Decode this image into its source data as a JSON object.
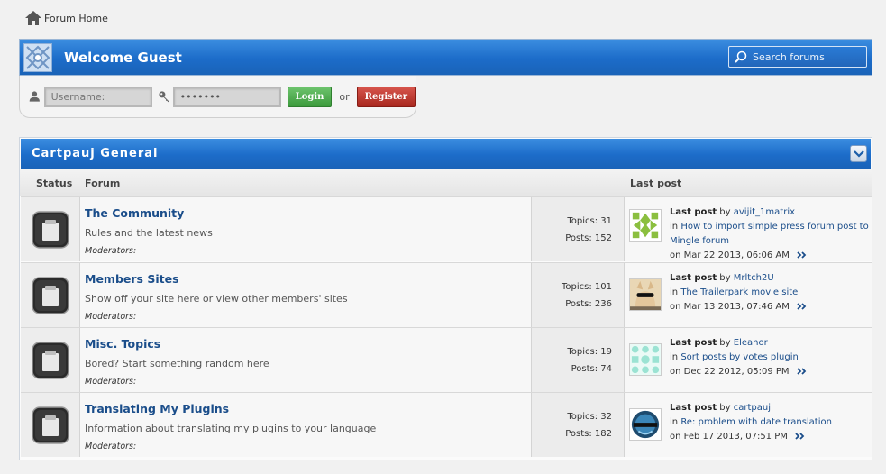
{
  "breadcrumb": {
    "home_label": "Forum Home"
  },
  "welcome": {
    "title": "Welcome Guest",
    "search_placeholder": "Search forums"
  },
  "login": {
    "username_placeholder": "Username:",
    "password_value": "•••••••",
    "login_label": "Login",
    "or_text": "or",
    "register_label": "Register"
  },
  "group": {
    "title": "Cartpauj General",
    "headers": {
      "status": "Status",
      "forum": "Forum",
      "last_post": "Last post"
    }
  },
  "forums": [
    {
      "title": "The Community",
      "description": "Rules and the latest news",
      "moderators": "Moderators:",
      "topics": "Topics: 31",
      "posts": "Posts: 152",
      "last_label": "Last post",
      "by": "by",
      "author": "avijit_1matrix",
      "in": "in",
      "topic_line1": "How to import simple press forum post to",
      "topic_line2": "Mingle forum",
      "date": "on Mar 22 2013, 06:06 AM"
    },
    {
      "title": "Members Sites",
      "description": "Show off your site here or view other members' sites",
      "moderators": "Moderators:",
      "topics": "Topics: 101",
      "posts": "Posts: 236",
      "last_label": "Last post",
      "by": "by",
      "author": "Mrltch2U",
      "in": "in",
      "topic_line1": "The Trailerpark movie site",
      "topic_line2": "",
      "date": "on Mar 13 2013, 07:46 AM"
    },
    {
      "title": "Misc. Topics",
      "description": "Bored? Start something random here",
      "moderators": "Moderators:",
      "topics": "Topics: 19",
      "posts": "Posts: 74",
      "last_label": "Last post",
      "by": "by",
      "author": "Eleanor",
      "in": "in",
      "topic_line1": "Sort posts by votes plugin",
      "topic_line2": "",
      "date": "on Dec 22 2012, 05:09 PM"
    },
    {
      "title": "Translating My Plugins",
      "description": "Information about translating my plugins to your language",
      "moderators": "Moderators:",
      "topics": "Topics: 32",
      "posts": "Posts: 182",
      "last_label": "Last post",
      "by": "by",
      "author": "cartpauj",
      "in": "in",
      "topic_line1": "Re: problem with date translation",
      "topic_line2": "",
      "date": "on Feb 17 2013, 07:51 PM"
    }
  ],
  "icons": {
    "home": "home-icon",
    "user": "user-icon",
    "key": "key-icon",
    "search": "search-icon",
    "collapse": "chevron-down-icon",
    "status": "forum-status-icon",
    "goto": "double-chevron-right-icon"
  },
  "colors": {
    "header_blue": "#1c6cc9",
    "link_blue": "#1a4d8a",
    "login_green": "#3c9a3c",
    "register_red": "#a8281f"
  }
}
